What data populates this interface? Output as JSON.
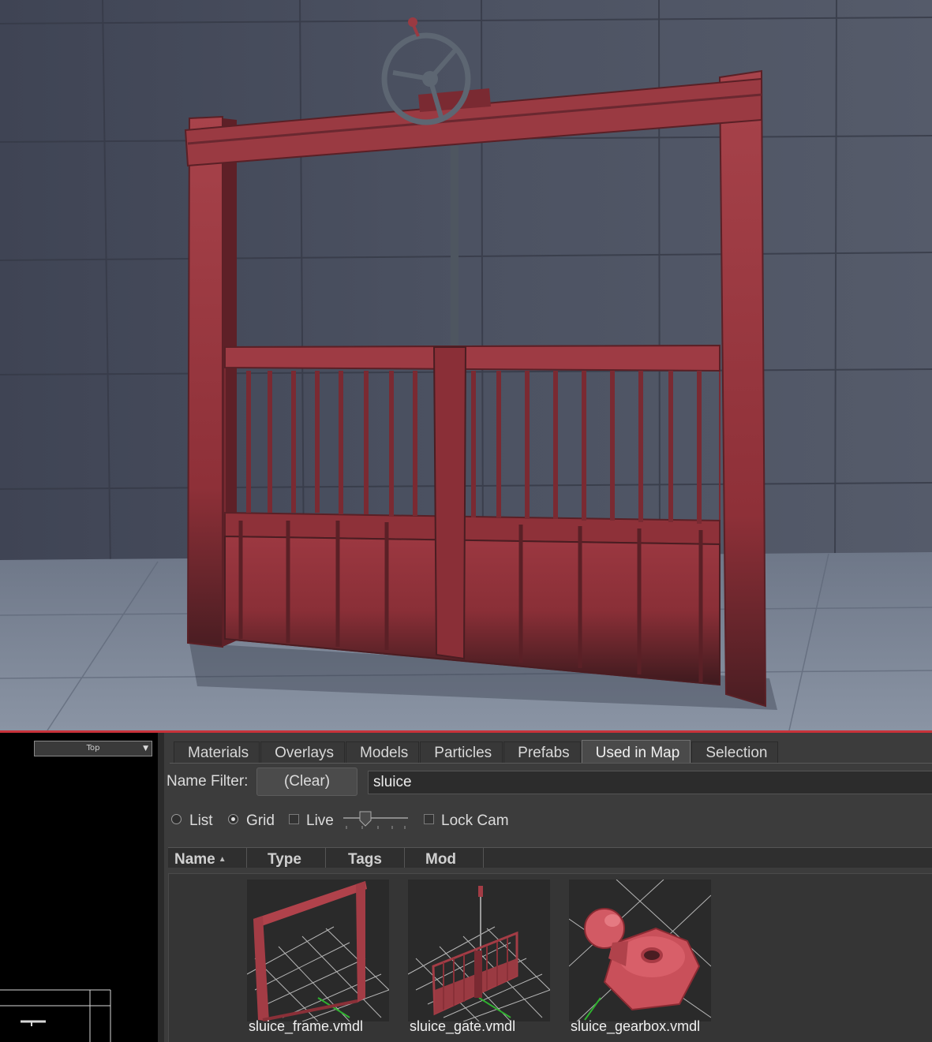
{
  "viewport": {
    "colors": {
      "wall": "#4a5060",
      "floor": "#7a8494",
      "gate": "#9a3a42",
      "gate_dark": "#5a2228"
    }
  },
  "left_view": {
    "view_select": {
      "value": "Top",
      "icon": "chevron-down-icon"
    }
  },
  "browser": {
    "tabs": [
      {
        "label": "Materials",
        "active": false
      },
      {
        "label": "Overlays",
        "active": false
      },
      {
        "label": "Models",
        "active": false
      },
      {
        "label": "Particles",
        "active": false
      },
      {
        "label": "Prefabs",
        "active": false
      },
      {
        "label": "Used in Map",
        "active": true
      },
      {
        "label": "Selection",
        "active": false
      }
    ],
    "filter": {
      "label": "Name Filter:",
      "clear_label": "(Clear)",
      "value": "sluice"
    },
    "view_options": {
      "list_label": "List",
      "grid_label": "Grid",
      "live_label": "Live",
      "lock_cam_label": "Lock Cam",
      "selected": "grid"
    },
    "columns": [
      {
        "label": "Name",
        "sorted": true
      },
      {
        "label": "Type"
      },
      {
        "label": "Tags"
      },
      {
        "label": "Mod"
      }
    ],
    "assets": [
      {
        "name": "sluice_frame.vmdl"
      },
      {
        "name": "sluice_gate.vmdl"
      },
      {
        "name": "sluice_gearbox.vmdl"
      }
    ]
  },
  "accent_color": "#c8323a"
}
